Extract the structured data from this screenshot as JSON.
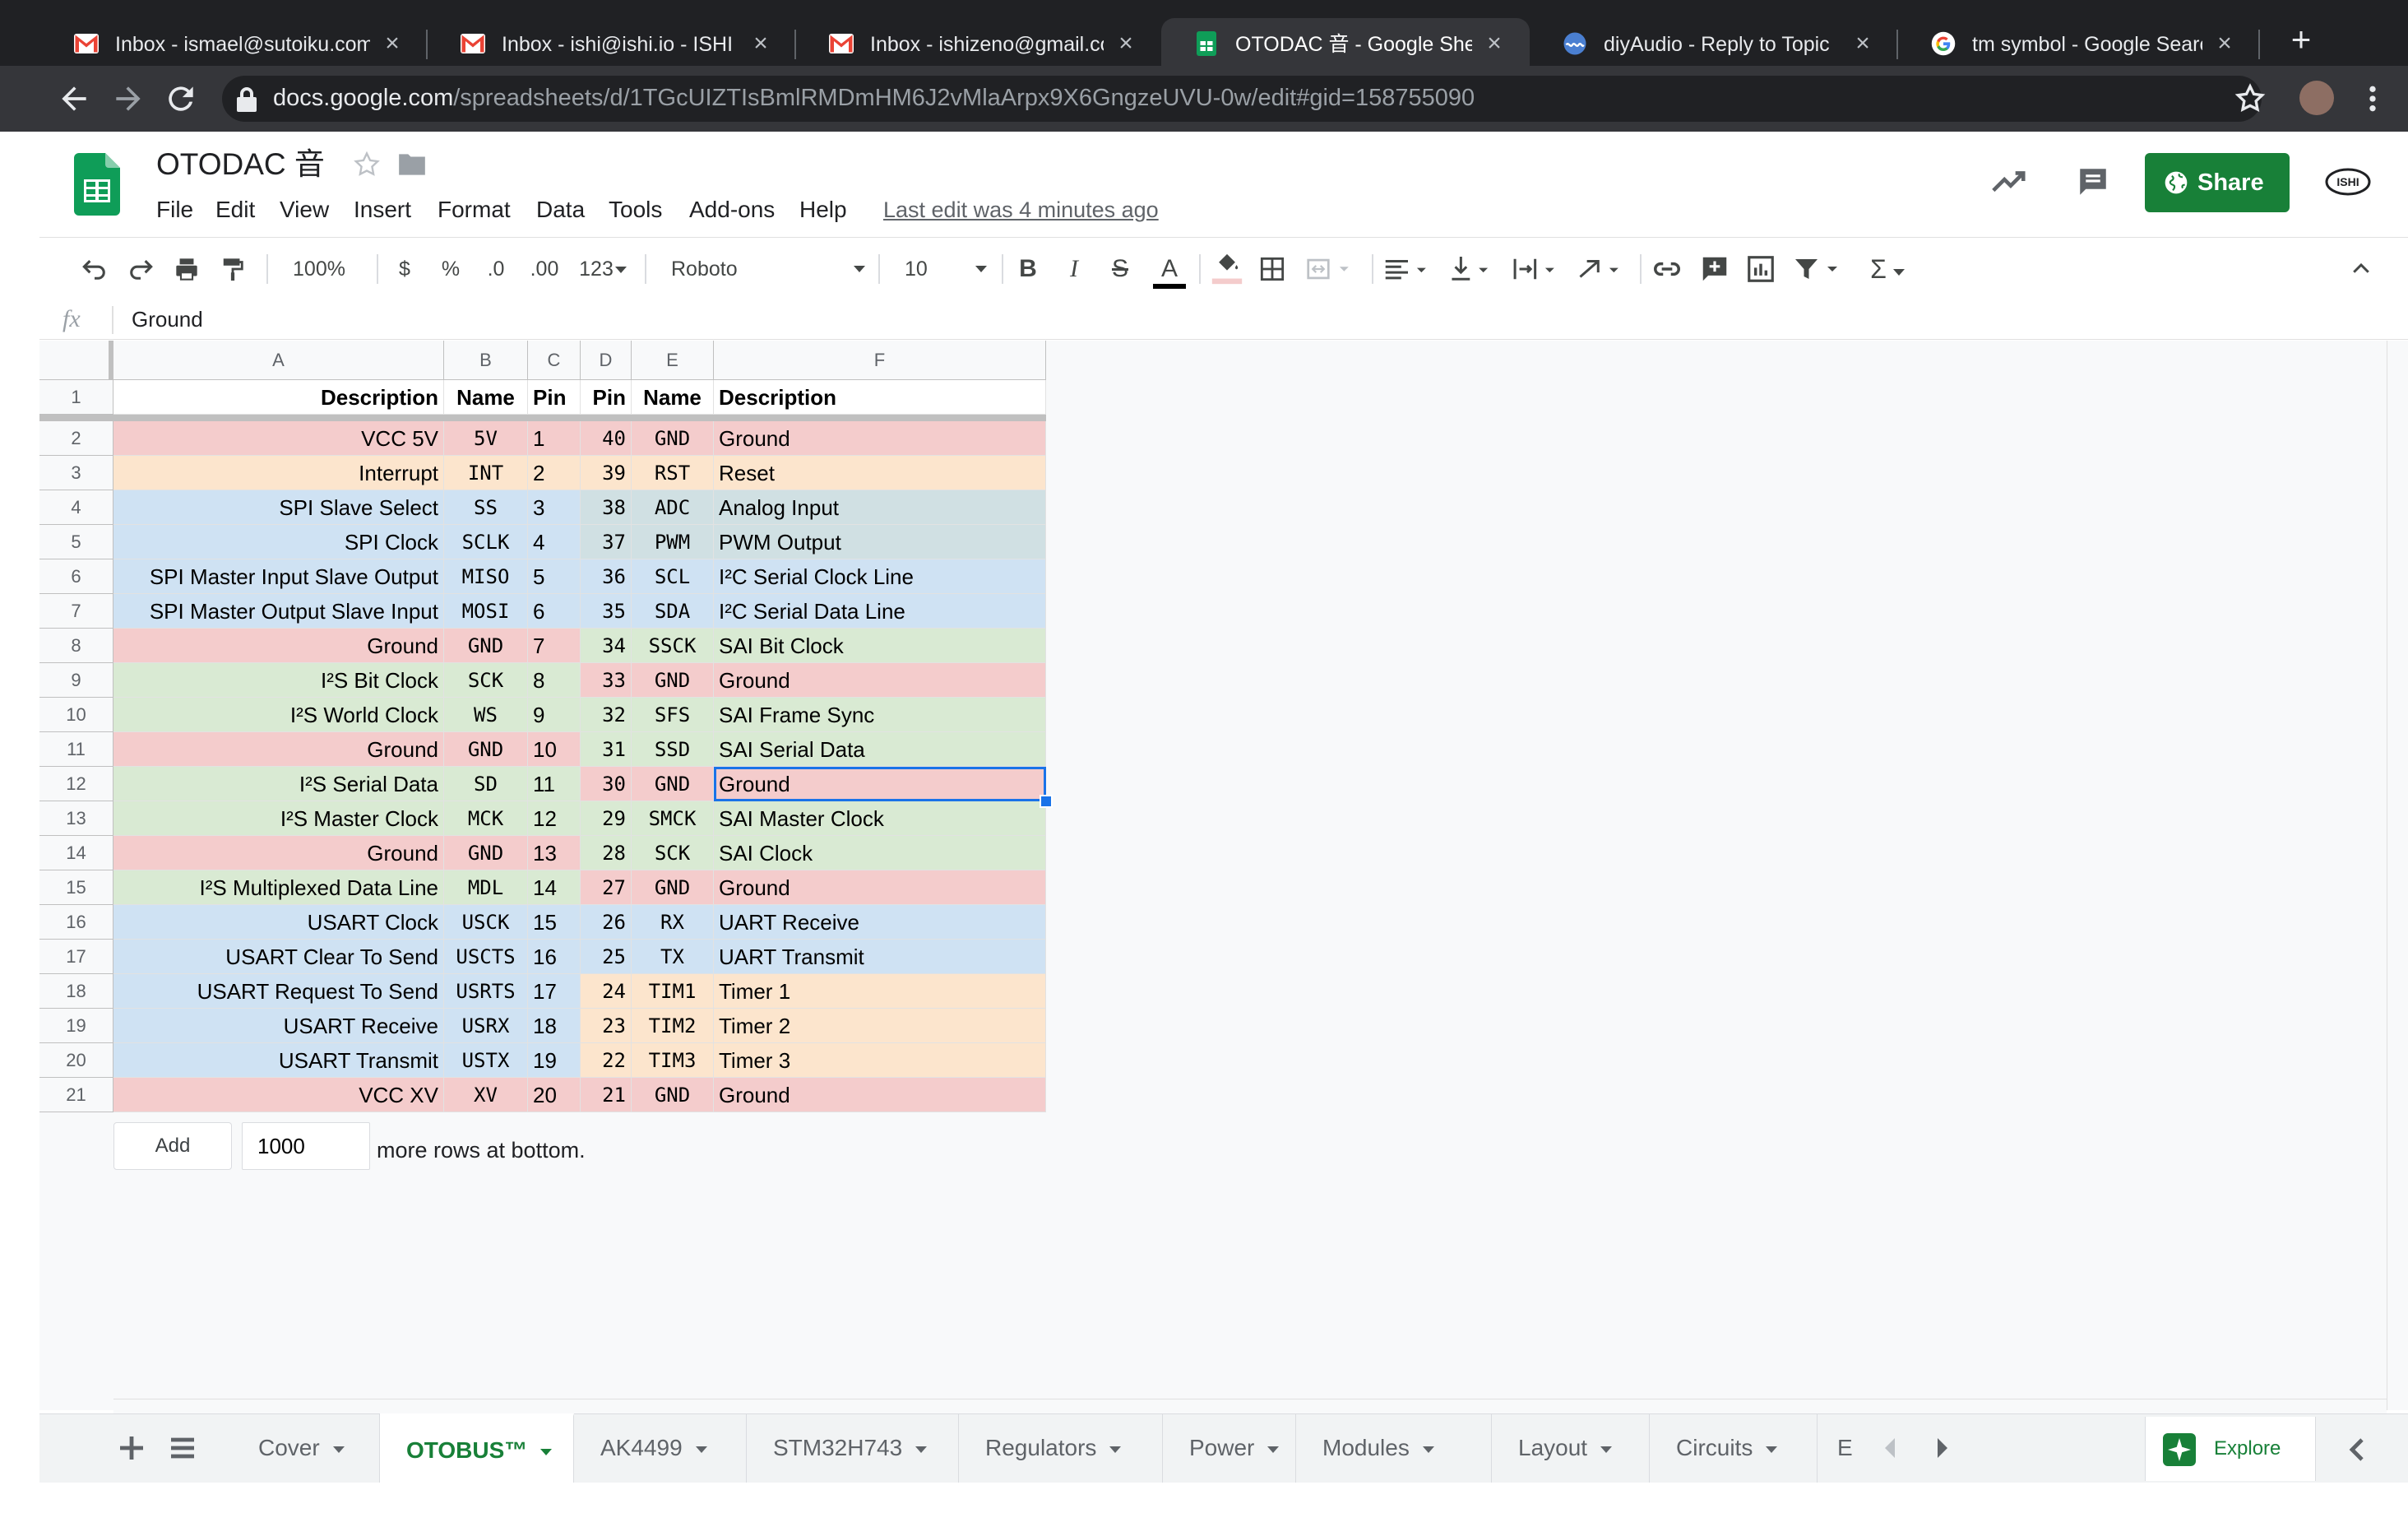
{
  "browser": {
    "tabs": [
      {
        "title": "Inbox - ismael@sutoiku.com",
        "favicon": "gmail-icon"
      },
      {
        "title": "Inbox - ishi@ishi.io - ISHI Ma",
        "favicon": "gmail-icon"
      },
      {
        "title": "Inbox - ishizeno@gmail.com",
        "favicon": "gmail-icon"
      },
      {
        "title": "OTODAC 音 - Google Sheets",
        "favicon": "sheets-icon",
        "active": true
      },
      {
        "title": "diyAudio - Reply to Topic",
        "favicon": "diyaudio-icon"
      },
      {
        "title": "tm symbol - Google Search",
        "favicon": "google-icon"
      }
    ],
    "new_tab": "+",
    "url_host": "docs.google.com",
    "url_path": "/spreadsheets/d/1TGcUIZTIsBmlRMDmHM6J2vMlaArpx9X6GngzeUVU-0w/edit#gid=158755090"
  },
  "doc": {
    "title": "OTODAC 音",
    "menus": [
      "File",
      "Edit",
      "View",
      "Insert",
      "Format",
      "Data",
      "Tools",
      "Add-ons",
      "Help"
    ],
    "last_edit": "Last edit was 4 minutes ago",
    "share": "Share",
    "account": "ISHI"
  },
  "toolbar": {
    "zoom": "100%",
    "currency": "$",
    "percent": "%",
    "dec_decrease": ".0",
    "dec_increase": ".00",
    "format_more": "123",
    "font": "Roboto",
    "font_size": "10",
    "bold": "B",
    "italic": "I",
    "strike": "S",
    "text_color": "A",
    "functions": "Σ"
  },
  "formula_bar": {
    "fx": "fx",
    "content": "Ground"
  },
  "grid": {
    "columns": [
      "A",
      "B",
      "C",
      "D",
      "E",
      "F"
    ],
    "header_row": [
      "Description",
      "Name",
      "Pin",
      "Pin",
      "Name",
      "Description"
    ],
    "rows": [
      {
        "n": "2",
        "a": "VCC 5V",
        "b": "5V",
        "c": "1",
        "d": "40",
        "e": "GND",
        "f": "Ground",
        "left": "red",
        "right": "red"
      },
      {
        "n": "3",
        "a": "Interrupt",
        "b": "INT",
        "c": "2",
        "d": "39",
        "e": "RST",
        "f": "Reset",
        "left": "orange",
        "right": "orange"
      },
      {
        "n": "4",
        "a": "SPI Slave Select",
        "b": "SS",
        "c": "3",
        "d": "38",
        "e": "ADC",
        "f": "Analog Input",
        "left": "blue",
        "right": "teal"
      },
      {
        "n": "5",
        "a": "SPI Clock",
        "b": "SCLK",
        "c": "4",
        "d": "37",
        "e": "PWM",
        "f": "PWM Output",
        "left": "blue",
        "right": "teal"
      },
      {
        "n": "6",
        "a": "SPI Master Input Slave Output",
        "b": "MISO",
        "c": "5",
        "d": "36",
        "e": "SCL",
        "f": "I²C Serial Clock Line",
        "left": "blue",
        "right": "blue"
      },
      {
        "n": "7",
        "a": "SPI Master Output Slave Input",
        "b": "MOSI",
        "c": "6",
        "d": "35",
        "e": "SDA",
        "f": "I²C Serial Data Line",
        "left": "blue",
        "right": "blue"
      },
      {
        "n": "8",
        "a": "Ground",
        "b": "GND",
        "c": "7",
        "d": "34",
        "e": "SSCK",
        "f": "SAI Bit Clock",
        "left": "red",
        "right": "green"
      },
      {
        "n": "9",
        "a": "I²S Bit Clock",
        "b": "SCK",
        "c": "8",
        "d": "33",
        "e": "GND",
        "f": "Ground",
        "left": "green",
        "right": "red"
      },
      {
        "n": "10",
        "a": "I²S World Clock",
        "b": "WS",
        "c": "9",
        "d": "32",
        "e": "SFS",
        "f": "SAI Frame Sync",
        "left": "green",
        "right": "green"
      },
      {
        "n": "11",
        "a": "Ground",
        "b": "GND",
        "c": "10",
        "d": "31",
        "e": "SSD",
        "f": "SAI Serial Data",
        "left": "red",
        "right": "green"
      },
      {
        "n": "12",
        "a": "I²S Serial Data",
        "b": "SD",
        "c": "11",
        "d": "30",
        "e": "GND",
        "f": "Ground",
        "left": "green",
        "right": "red"
      },
      {
        "n": "13",
        "a": "I²S Master Clock",
        "b": "MCK",
        "c": "12",
        "d": "29",
        "e": "SMCK",
        "f": "SAI Master Clock",
        "left": "green",
        "right": "green"
      },
      {
        "n": "14",
        "a": "Ground",
        "b": "GND",
        "c": "13",
        "d": "28",
        "e": "SCK",
        "f": "SAI Clock",
        "left": "red",
        "right": "green"
      },
      {
        "n": "15",
        "a": "I²S Multiplexed Data Line",
        "b": "MDL",
        "c": "14",
        "d": "27",
        "e": "GND",
        "f": "Ground",
        "left": "green",
        "right": "red"
      },
      {
        "n": "16",
        "a": "USART Clock",
        "b": "USCK",
        "c": "15",
        "d": "26",
        "e": "RX",
        "f": "UART Receive",
        "left": "blue",
        "right": "blue"
      },
      {
        "n": "17",
        "a": "USART Clear To Send",
        "b": "USCTS",
        "c": "16",
        "d": "25",
        "e": "TX",
        "f": "UART Transmit",
        "left": "blue",
        "right": "blue"
      },
      {
        "n": "18",
        "a": "USART Request To Send",
        "b": "USRTS",
        "c": "17",
        "d": "24",
        "e": "TIM1",
        "f": "Timer 1",
        "left": "blue",
        "right": "orange"
      },
      {
        "n": "19",
        "a": "USART Receive",
        "b": "USRX",
        "c": "18",
        "d": "23",
        "e": "TIM2",
        "f": "Timer 2",
        "left": "blue",
        "right": "orange"
      },
      {
        "n": "20",
        "a": "USART Transmit",
        "b": "USTX",
        "c": "19",
        "d": "22",
        "e": "TIM3",
        "f": "Timer 3",
        "left": "blue",
        "right": "orange"
      },
      {
        "n": "21",
        "a": "VCC XV",
        "b": "XV",
        "c": "20",
        "d": "21",
        "e": "GND",
        "f": "Ground",
        "left": "red",
        "right": "red"
      }
    ],
    "selected_cell": "F12",
    "add_button": "Add",
    "add_rows_value": "1000",
    "add_rows_suffix": "more rows at bottom."
  },
  "colors": {
    "red": "#f4cccc",
    "orange": "#fce5cd",
    "blue": "#cfe2f3",
    "teal": "#d0e0e3",
    "green": "#d9ead3",
    "accent": "#188038",
    "selection": "#1a73e8"
  },
  "sheets": {
    "tabs": [
      "Cover",
      "OTOBUS™",
      "AK4499",
      "STM32H743",
      "Regulators",
      "Power",
      "Modules",
      "Layout",
      "Circuits",
      "E"
    ],
    "active": "OTOBUS™",
    "explore": "Explore"
  }
}
